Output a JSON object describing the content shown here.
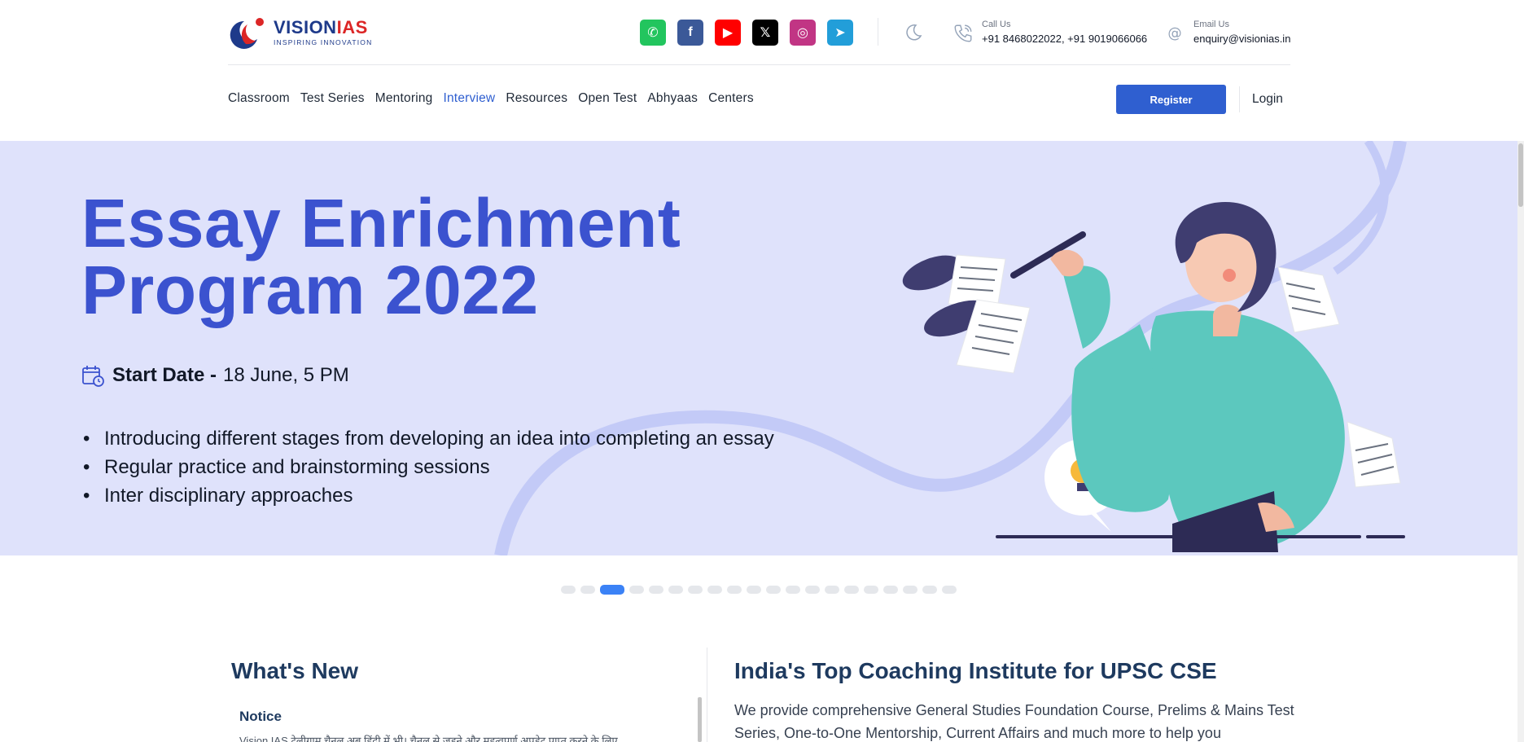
{
  "brand": {
    "name_part1": "VISION",
    "name_part2": "IAS",
    "tagline": "INSPIRING INNOVATION",
    "colors": {
      "primary": "#1e3a8a",
      "accent": "#dc2626",
      "button": "#2f5fd0"
    }
  },
  "socials": [
    {
      "icon": "whatsapp-icon",
      "color": "#22c55e",
      "glyph": "✆"
    },
    {
      "icon": "facebook-icon",
      "color": "#3b5998",
      "glyph": "f"
    },
    {
      "icon": "youtube-icon",
      "color": "#ff0000",
      "glyph": "▶"
    },
    {
      "icon": "x-icon",
      "color": "#000000",
      "glyph": "𝕏"
    },
    {
      "icon": "instagram-icon",
      "color": "#c13584",
      "glyph": "◎"
    },
    {
      "icon": "telegram-icon",
      "color": "#229ed9",
      "glyph": "➤"
    }
  ],
  "contact": {
    "call_label": "Call Us",
    "call_value": "+91 8468022022, +91 9019066066",
    "email_label": "Email Us",
    "email_value": "enquiry@visionias.in"
  },
  "nav": {
    "items": [
      "Classroom",
      "Test Series",
      "Mentoring",
      "Interview",
      "Resources",
      "Open Test",
      "Abhyaas",
      "Centers"
    ],
    "active": "Interview",
    "register_label": "Register",
    "login_label": "Login"
  },
  "banner": {
    "title_line1": "Essay Enrichment",
    "title_line2": "Program 2022",
    "start_label": "Start Date -",
    "start_value": "18 June, 5 PM",
    "points": [
      "Introducing different stages from developing an idea into completing an essay",
      "Regular practice and brainstorming sessions",
      "Inter disciplinary approaches"
    ]
  },
  "carousel": {
    "total_slides": 20,
    "active_index": 2
  },
  "whats_new": {
    "title": "What's New",
    "notice_heading": "Notice",
    "notice_text": "Vision IAS टेलीग्राम चैनल अब हिंदी में भी। चैनल से जुड़ने और महत्वपूर्ण अपडेट प्राप्त करने के लिए"
  },
  "about": {
    "title": "India's Top Coaching Institute for UPSC CSE",
    "text": "We provide comprehensive General Studies Foundation Course, Prelims & Mains Test Series, One-to-One Mentorship, Current Affairs and much more to help you"
  }
}
